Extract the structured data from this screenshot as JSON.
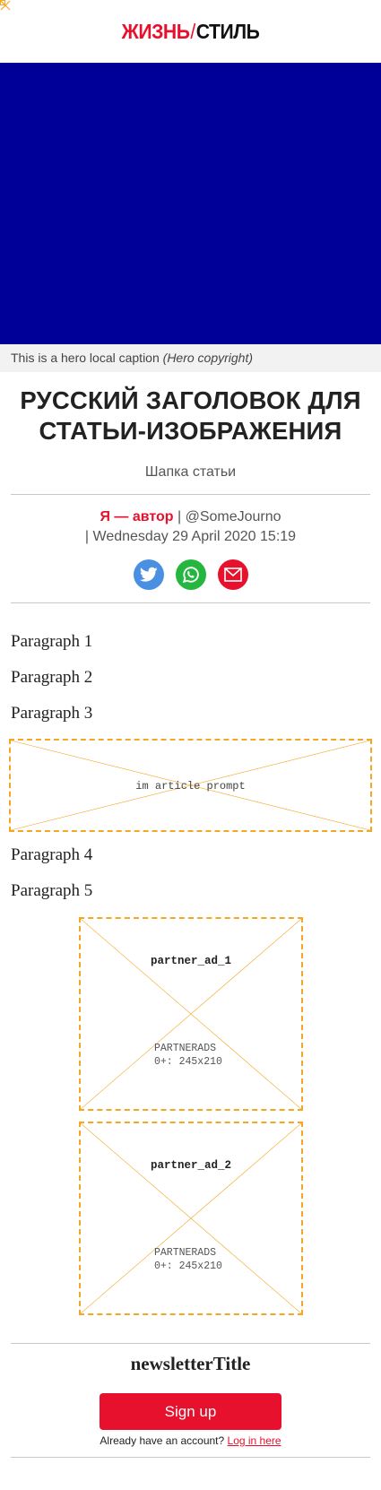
{
  "header": {
    "logo_part1": "ЖИЗНЬ",
    "logo_sep": "/",
    "logo_part2": "СТИЛЬ"
  },
  "hero": {
    "color": "#000099",
    "caption": "This is a hero local caption",
    "copyright": "(Hero copyright)"
  },
  "article": {
    "title": "РУССКИЙ ЗАГОЛОВОК ДЛЯ СТАТЬИ-ИЗОБРАЖЕНИЯ",
    "standfirst": "Шапка статьи",
    "author": "Я — автор",
    "handle": "| @SomeJourno",
    "date": "| Wednesday 29 April 2020 15:19",
    "paragraphs": [
      "Paragraph 1",
      "Paragraph 2",
      "Paragraph 3",
      "Paragraph 4",
      "Paragraph 5"
    ],
    "prompt_label": "im article prompt"
  },
  "share": {
    "icons": [
      "twitter-icon",
      "whatsapp-icon",
      "email-icon"
    ],
    "colors": {
      "twitter": "#4a90e2",
      "whatsapp": "#25b63f",
      "email": "#e8112d"
    }
  },
  "ads": [
    {
      "name": "partner_ad_1",
      "type": "PARTNERADS",
      "size": "0+: 245x210"
    },
    {
      "name": "partner_ad_2",
      "type": "PARTNERADS",
      "size": "0+: 245x210"
    }
  ],
  "newsletter": {
    "title": "newsletterTitle",
    "signup_label": "Sign up",
    "login_prompt": "Already have an account?",
    "login_link": "Log in here"
  },
  "colors": {
    "accent": "#e8112d",
    "placeholder_border": "#f5a623"
  }
}
